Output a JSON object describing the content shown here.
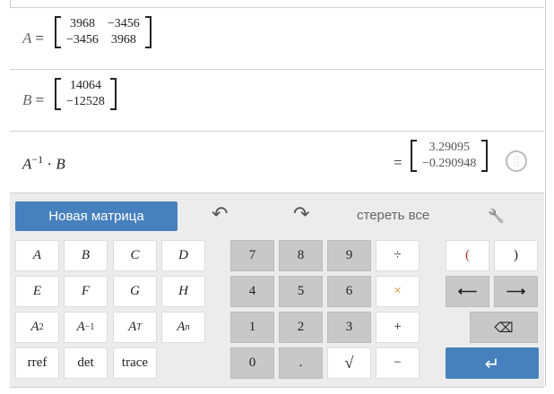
{
  "matrix_a": {
    "label": "A",
    "eq": "=",
    "cells": [
      [
        "3968",
        "−3456"
      ],
      [
        "−3456",
        "3968"
      ]
    ]
  },
  "matrix_b": {
    "label": "B",
    "eq": "=",
    "cells": [
      [
        "14064"
      ],
      [
        "−12528"
      ]
    ]
  },
  "result": {
    "base": "A",
    "exp": "−1",
    "dot": "·",
    "rhs": "B",
    "eq": "=",
    "cells": [
      [
        "3.29095"
      ],
      [
        "−0.290948"
      ]
    ]
  },
  "toolbar": {
    "new_matrix": "Новая матрица",
    "undo": "↶",
    "redo": "↷",
    "clear_all": "стереть все",
    "settings": "🔧"
  },
  "keys": {
    "letters": [
      "A",
      "B",
      "C",
      "D",
      "E",
      "F",
      "G",
      "H"
    ],
    "powers": {
      "base": "A",
      "sq": "2",
      "inv": "−1",
      "t": "T",
      "n": "n"
    },
    "funcs": [
      "rref",
      "det",
      "trace"
    ],
    "digits": [
      "7",
      "8",
      "9",
      "4",
      "5",
      "6",
      "1",
      "2",
      "3",
      "0",
      "."
    ],
    "ops": {
      "div": "÷",
      "mul": "×",
      "add": "+",
      "sub": "−",
      "sqrt": "√"
    },
    "paren_open": "(",
    "paren_close": ")",
    "left": "⟵",
    "right": "⟶",
    "backspace": "⌫",
    "enter": "↵"
  },
  "colors": {
    "accent": "#4680bd",
    "key_gray": "#c8c8c8",
    "pad_bg": "#ececec"
  }
}
